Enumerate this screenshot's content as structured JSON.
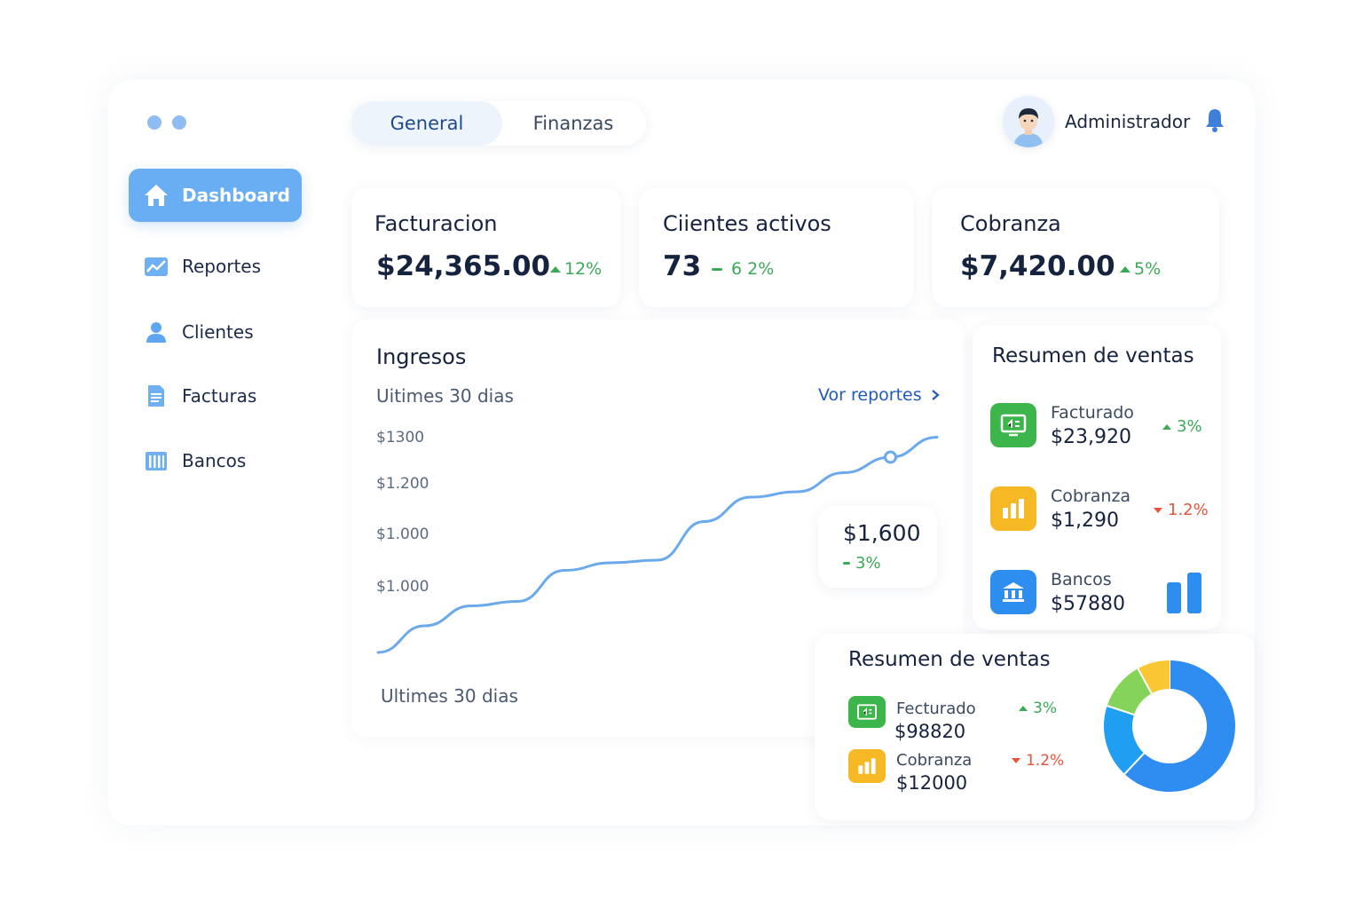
{
  "sidebar": {
    "items": [
      {
        "label": "Dashboard",
        "icon": "home-icon",
        "active": true
      },
      {
        "label": "Reportes",
        "icon": "chart-icon"
      },
      {
        "label": "Clientes",
        "icon": "user-icon"
      },
      {
        "label": "Facturas",
        "icon": "invoice-icon"
      },
      {
        "label": "Bancos",
        "icon": "bank-icon"
      }
    ]
  },
  "tabs": [
    {
      "label": "General",
      "active": true
    },
    {
      "label": "Finanzas"
    }
  ],
  "user": {
    "name": "Administrador",
    "icon": "bell-icon"
  },
  "kpis": [
    {
      "title": "Facturacion",
      "value": "$24,365.00",
      "delta": "12%",
      "trend": "up"
    },
    {
      "title": "Ciientes activos",
      "value": "73",
      "delta": "6 2%",
      "trend": "flat"
    },
    {
      "title": "Cobranza",
      "value": "$7,420.00",
      "delta": "5%",
      "trend": "up"
    }
  ],
  "ingresos": {
    "title": "Ingresos",
    "subtitle": "Uitimes 30 dias",
    "link": "Vor reportes",
    "footer": "Ultimes 30 dias",
    "tooltip": {
      "value": "$1,600",
      "delta": "3%"
    }
  },
  "chart_data": {
    "type": "line",
    "title": "Ingresos",
    "y_tick_labels": [
      "$1300",
      "$1.200",
      "$1.000",
      "$1.000"
    ],
    "x": [
      0,
      1,
      2,
      3,
      4,
      5,
      6,
      7,
      8,
      9,
      10,
      11,
      12
    ],
    "series": [
      {
        "values": [
          860,
          920,
          965,
          975,
          1045,
          1062,
          1068,
          1155,
          1210,
          1222,
          1265,
          1300,
          1345
        ]
      }
    ],
    "highlight_index": 11,
    "ylim": [
      850,
      1350
    ],
    "color": "#6aa9ec"
  },
  "summary1": {
    "title": "Resumen de ventas",
    "rows": [
      {
        "label": "Facturado",
        "value": "$23,920",
        "delta": "3%",
        "trend": "up",
        "icon": "invoice-screen-icon",
        "color": "#3cb54a"
      },
      {
        "label": "Cobranza",
        "value": "$1,290",
        "delta": "1.2%",
        "trend": "down",
        "icon": "bar-chart-icon",
        "color": "#f6b825"
      },
      {
        "label": "Bancos",
        "value": "$57880",
        "icon": "bank-building-icon",
        "color": "#2e8ef0"
      }
    ]
  },
  "summary2": {
    "title": "Resumen de ventas",
    "rows": [
      {
        "label": "Fecturado",
        "value": "$98820",
        "delta": "3%",
        "trend": "up",
        "icon": "invoice-screen-icon",
        "color": "#3cb54a"
      },
      {
        "label": "Cobranza",
        "value": "$12000",
        "delta": "1.2%",
        "trend": "down",
        "icon": "bar-chart-icon",
        "color": "#f6b825"
      }
    ],
    "donut": [
      {
        "value": 62,
        "color": "#2f8cf0"
      },
      {
        "value": 18,
        "color": "#1f9ef2"
      },
      {
        "value": 12,
        "color": "#86d35a"
      },
      {
        "value": 8,
        "color": "#f9c734"
      }
    ]
  },
  "colors": {
    "accent": "#69aef2",
    "positive": "#3aaa55",
    "negative": "#e8543b",
    "line": "#6aa9ec"
  }
}
